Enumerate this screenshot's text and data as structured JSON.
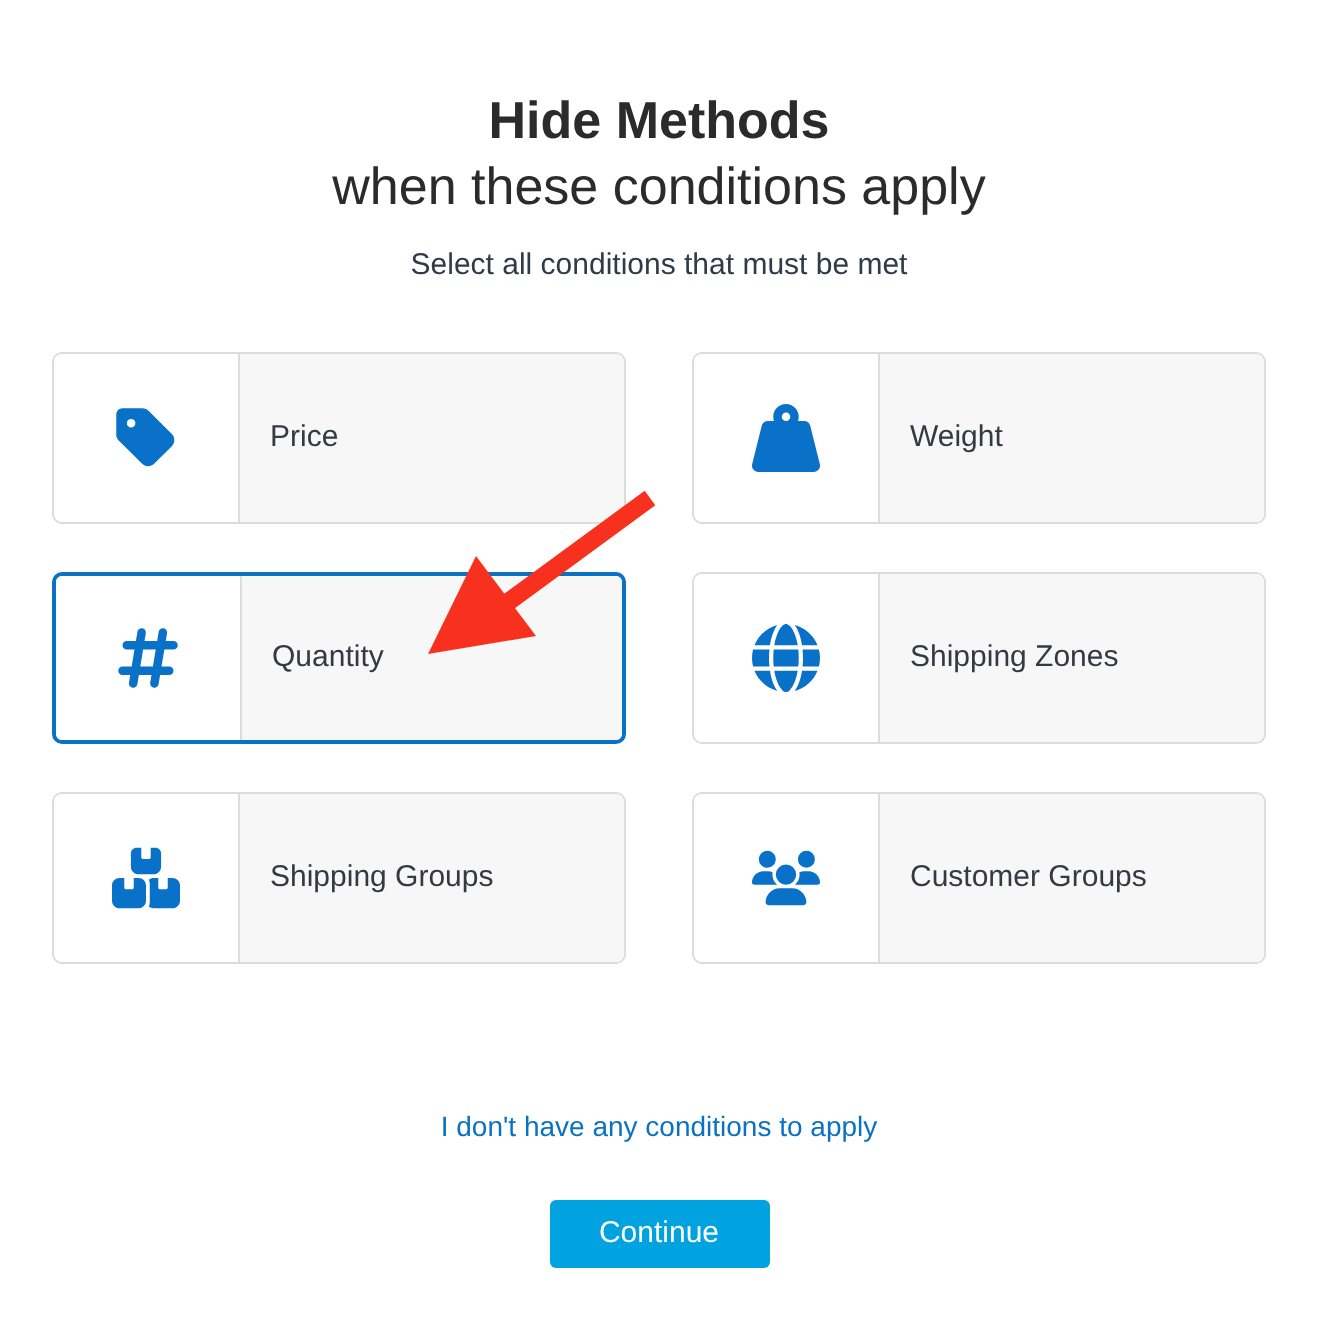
{
  "dialog": {
    "title": "Hide Methods",
    "subtitle": "when these conditions apply",
    "instruction": "Select all conditions that must be met"
  },
  "conditions": [
    {
      "kind": "price",
      "label": "Price",
      "selected": false
    },
    {
      "kind": "weight",
      "label": "Weight",
      "selected": false
    },
    {
      "kind": "quantity",
      "label": "Quantity",
      "selected": true
    },
    {
      "kind": "zones",
      "label": "Shipping Zones",
      "selected": false
    },
    {
      "kind": "groups",
      "label": "Shipping Groups",
      "selected": false
    },
    {
      "kind": "customers",
      "label": "Customer Groups",
      "selected": false
    }
  ],
  "skip_link": "I don't have any conditions to apply",
  "buttons": [
    {
      "label": "Continue"
    }
  ]
}
